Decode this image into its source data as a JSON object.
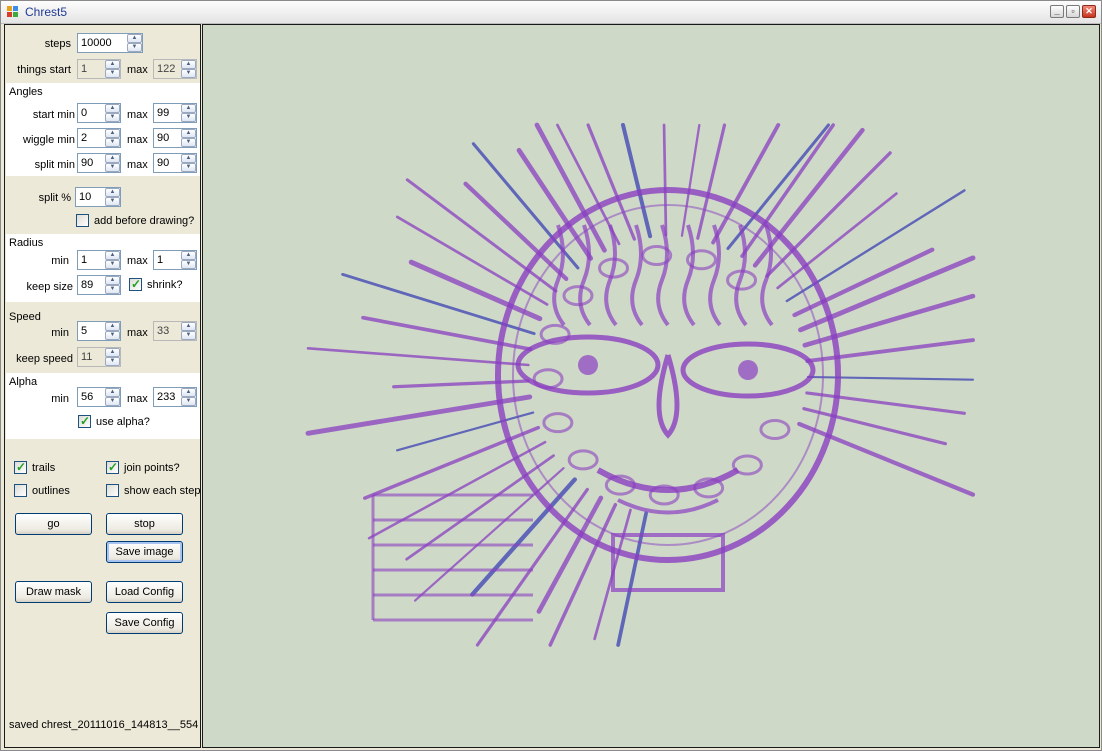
{
  "window": {
    "title": "Chrest5"
  },
  "controls": {
    "steps": {
      "label": "steps",
      "value": "10000"
    },
    "things": {
      "label": "things start",
      "start": "1",
      "max_label": "max",
      "max": "122"
    },
    "angles": {
      "section": "Angles",
      "start": {
        "label": "start  min",
        "min": "0",
        "max_label": "max",
        "max": "99"
      },
      "wiggle": {
        "label": "wiggle  min",
        "min": "2",
        "max_label": "max",
        "max": "90"
      },
      "split": {
        "label": "split  min",
        "min": "90",
        "max_label": "max",
        "max": "90"
      }
    },
    "split_pct": {
      "label": "split %",
      "value": "10"
    },
    "add_before": {
      "label": "add before drawing?",
      "checked": false
    },
    "radius": {
      "section": "Radius",
      "min_label": "min",
      "min": "1",
      "max_label": "max",
      "max": "1",
      "keep_label": "keep size",
      "keep": "89",
      "shrink_label": "shrink?",
      "shrink": true
    },
    "speed": {
      "section": "Speed",
      "min_label": "min",
      "min": "5",
      "max_label": "max",
      "max": "33",
      "keep_label": "keep speed",
      "keep": "11"
    },
    "alpha": {
      "section": "Alpha",
      "min_label": "min",
      "min": "56",
      "max_label": "max",
      "max": "233",
      "use_label": "use alpha?",
      "use": true
    },
    "trails": {
      "label": "trails",
      "checked": true
    },
    "join": {
      "label": "join points?",
      "checked": true
    },
    "outlines": {
      "label": "outlines",
      "checked": false
    },
    "show_each": {
      "label": "show each step",
      "checked": false
    }
  },
  "buttons": {
    "go": "go",
    "stop": "stop",
    "save_image": "Save image",
    "draw_mask": "Draw mask",
    "load_config": "Load Config",
    "save_config": "Save Config"
  },
  "status": "saved chrest_20111016_144813__554",
  "colors": {
    "canvas_bg": "#cfd9c8",
    "stroke_purple": "#8a3fc0",
    "stroke_blue": "#3b3fb3"
  },
  "icons": {
    "minimize": "minimize-icon",
    "maximize": "maximize-icon",
    "close": "close-icon"
  }
}
